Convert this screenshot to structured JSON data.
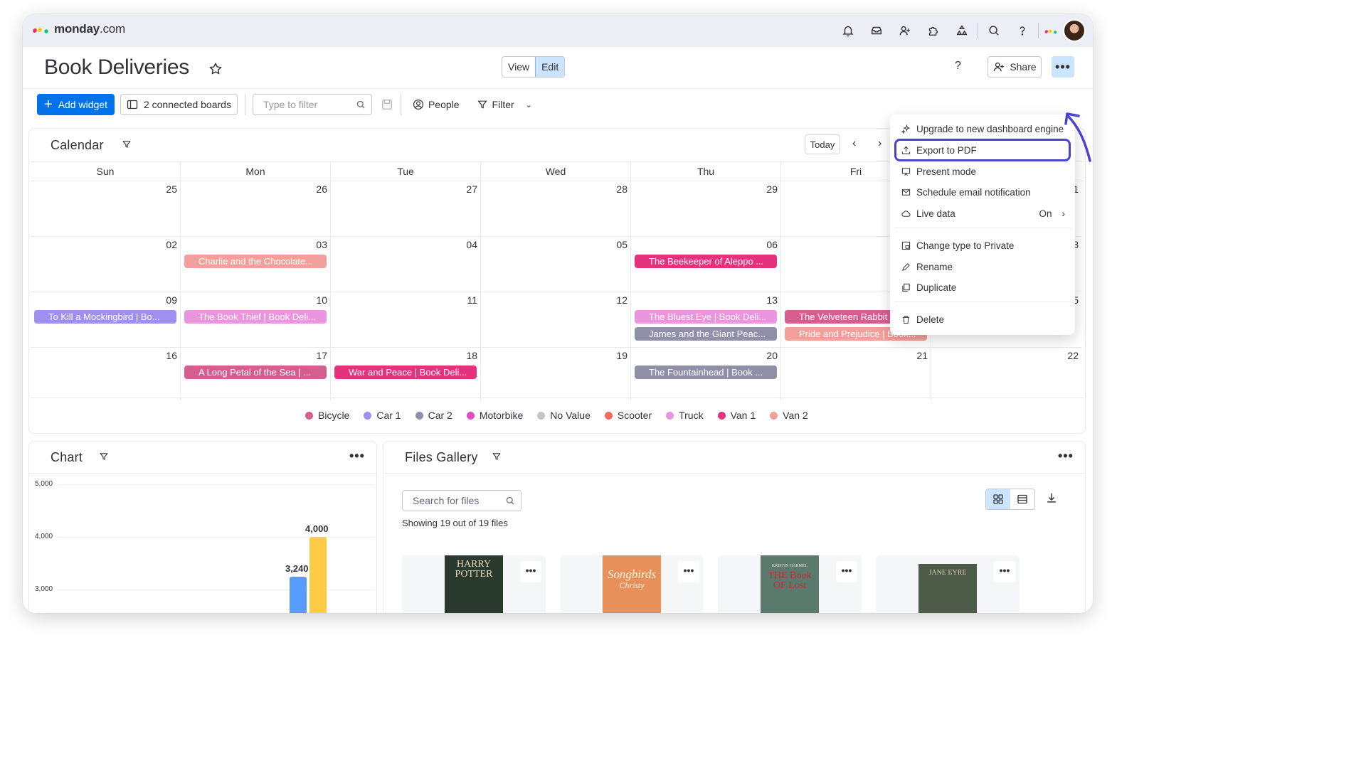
{
  "brand": {
    "name_bold": "monday",
    "name_suffix": ".com"
  },
  "page": {
    "title": "Book Deliveries",
    "view_label": "View",
    "edit_label": "Edit",
    "help": "?",
    "share_label": "Share",
    "more": "•••"
  },
  "toolbar": {
    "add_widget": "Add widget",
    "connected_boards": "2 connected boards",
    "filter_placeholder": "Type to filter",
    "people": "People",
    "filter": "Filter"
  },
  "calendar": {
    "title": "Calendar",
    "today": "Today",
    "days": [
      "Sun",
      "Mon",
      "Tue",
      "Wed",
      "Thu",
      "Fri"
    ],
    "weeks": [
      [
        "25",
        "26",
        "27",
        "28",
        "29",
        ""
      ],
      [
        "02",
        "03",
        "04",
        "05",
        "06",
        ""
      ],
      [
        "09",
        "10",
        "11",
        "12",
        "13",
        ""
      ],
      [
        "16",
        "17",
        "18",
        "19",
        "20",
        "21"
      ]
    ],
    "edge_nums": [
      "01",
      "8",
      "5",
      "22"
    ],
    "events": [
      {
        "text": "Charlie and the Chocolate...",
        "color": "#f3a09b"
      },
      {
        "text": "The Beekeeper of Aleppo ...",
        "color": "#e4337c"
      },
      {
        "text": "To Kill a Mockingbird | Bo...",
        "color": "#a18ff0"
      },
      {
        "text": "The Book Thief | Book Deli...",
        "color": "#ea95dd"
      },
      {
        "text": "The Bluest Eye | Book Deli...",
        "color": "#ea95dd"
      },
      {
        "text": "The Velveteen Rabbit | Bo...",
        "color": "#d65e8f"
      },
      {
        "text": "James and the Giant Peac...",
        "color": "#8f8fa8"
      },
      {
        "text": "Pride and Prejudice | Book...",
        "color": "#f3a09b"
      },
      {
        "text": "A Long Petal of the Sea | ...",
        "color": "#d65e8f"
      },
      {
        "text": "War and Peace | Book Deli...",
        "color": "#e4337c"
      },
      {
        "text": "The Fountainhead | Book ...",
        "color": "#8f8fa8"
      }
    ],
    "legend": [
      {
        "label": "Bicycle",
        "color": "#d65e8f"
      },
      {
        "label": "Car 1",
        "color": "#a18ff0"
      },
      {
        "label": "Car 2",
        "color": "#8f8fa8"
      },
      {
        "label": "Motorbike",
        "color": "#e04fc2"
      },
      {
        "label": "No Value",
        "color": "#c4c4c4"
      },
      {
        "label": "Scooter",
        "color": "#f26b5e"
      },
      {
        "label": "Truck",
        "color": "#ea95dd"
      },
      {
        "label": "Van 1",
        "color": "#e4337c"
      },
      {
        "label": "Van 2",
        "color": "#f3a09b"
      }
    ]
  },
  "chart": {
    "title": "Chart",
    "more": "•••",
    "y_ticks": [
      "5,000",
      "4,000",
      "3,000"
    ],
    "bar_labels": [
      "3,240",
      "4,000"
    ]
  },
  "chart_data": {
    "type": "bar",
    "values": [
      3240,
      4000
    ],
    "colors": [
      "#579bfc",
      "#fdcb44"
    ],
    "ylim": [
      2500,
      5000
    ]
  },
  "files": {
    "title": "Files Gallery",
    "more": "•••",
    "search_placeholder": "Search for files",
    "showing": "Showing 19 out of 19 files",
    "covers": [
      {
        "text": "HARRY POTTER",
        "bg": "#2a3a2e"
      },
      {
        "text": "Songbirds",
        "sub": "Christy",
        "bg": "#e7905a"
      },
      {
        "text": "THE Book OF Lost",
        "top": "KRISTIN HARMEL",
        "bg": "#5a7a6e"
      },
      {
        "text": "JANE EYRE",
        "bg": "#4d5a48"
      }
    ],
    "card_more": "•••"
  },
  "menu": {
    "items": [
      {
        "label": "Upgrade to new dashboard engine",
        "icon": "sparkle-icon"
      },
      {
        "label": "Export to PDF",
        "icon": "upload-icon"
      },
      {
        "label": "Present mode",
        "icon": "present-icon"
      },
      {
        "label": "Schedule email notification",
        "icon": "mail-icon"
      },
      {
        "label": "Live data",
        "icon": "cloud-icon",
        "value": "On"
      },
      {
        "label": "Change type to Private",
        "icon": "lock-board-icon"
      },
      {
        "label": "Rename",
        "icon": "pencil-icon"
      },
      {
        "label": "Duplicate",
        "icon": "duplicate-icon"
      },
      {
        "label": "Delete",
        "icon": "trash-icon"
      }
    ]
  }
}
